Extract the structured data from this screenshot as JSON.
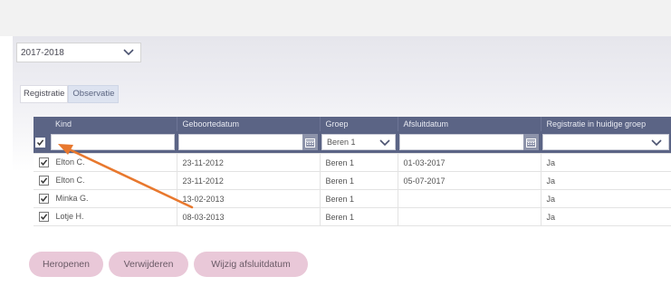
{
  "schoolyear": {
    "value": "2017-2018"
  },
  "tabs": [
    {
      "label": "Registratie"
    },
    {
      "label": "Observatie"
    }
  ],
  "table": {
    "columns": [
      "Kind",
      "Geboortedatum",
      "Groep",
      "Afsluitdatum",
      "Registratie in huidige groep"
    ],
    "filter": {
      "groep": "Beren 1"
    },
    "rows": [
      {
        "kind": "Elton C.",
        "geboortedatum": "23-11-2012",
        "groep": "Beren 1",
        "afsluitdatum": "01-03-2017",
        "registratie": "Ja"
      },
      {
        "kind": "Elton C.",
        "geboortedatum": "23-11-2012",
        "groep": "Beren 1",
        "afsluitdatum": "05-07-2017",
        "registratie": "Ja"
      },
      {
        "kind": "Minka G.",
        "geboortedatum": "13-02-2013",
        "groep": "Beren 1",
        "afsluitdatum": "",
        "registratie": "Ja"
      },
      {
        "kind": "Lotje H.",
        "geboortedatum": "08-03-2013",
        "groep": "Beren 1",
        "afsluitdatum": "",
        "registratie": "Ja"
      }
    ]
  },
  "buttons": {
    "reopen": "Heropenen",
    "delete": "Verwijderen",
    "change_date": "Wijzig afsluitdatum"
  },
  "colors": {
    "header": "#5b6485",
    "button": "#e9c8d8",
    "annotation_arrow": "#e8782e"
  },
  "icons": [
    "chevron-down-icon",
    "calendar-icon",
    "checkbox-icon",
    "annotation-arrow"
  ]
}
